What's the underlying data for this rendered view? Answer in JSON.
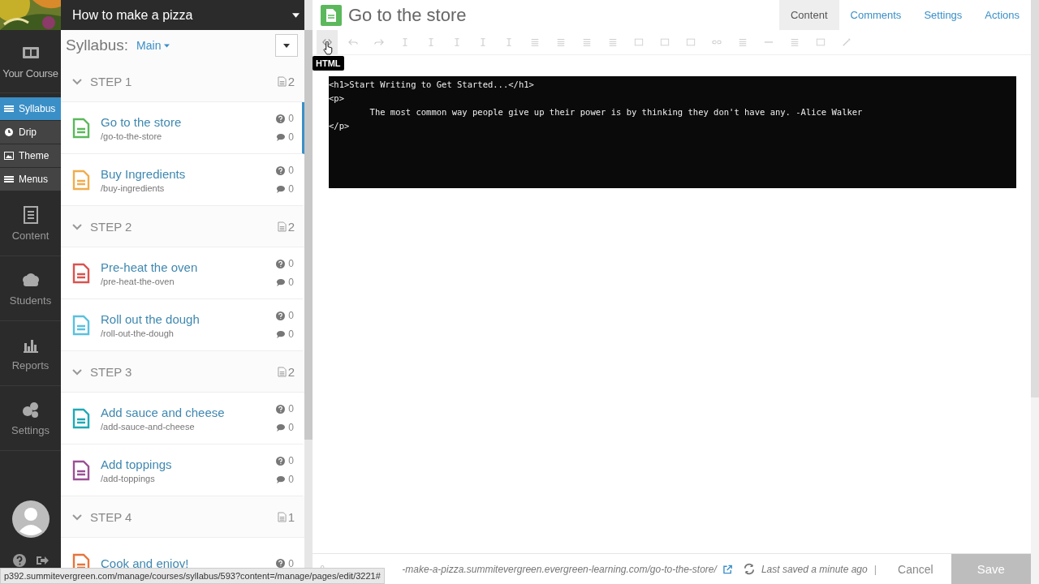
{
  "nav": {
    "items": [
      {
        "label": "Your Course",
        "kind": "large",
        "selected": false
      },
      {
        "label": "Syllabus",
        "kind": "small",
        "selected": true
      },
      {
        "label": "Drip",
        "kind": "small",
        "selected": false
      },
      {
        "label": "Theme",
        "kind": "small",
        "selected": false
      },
      {
        "label": "Menus",
        "kind": "small",
        "selected": false
      },
      {
        "label": "Content",
        "kind": "large",
        "selected": false
      },
      {
        "label": "Students",
        "kind": "large",
        "selected": false
      },
      {
        "label": "Reports",
        "kind": "large",
        "selected": false
      },
      {
        "label": "Settings",
        "kind": "large",
        "selected": false
      }
    ]
  },
  "course": {
    "title": "How to make a pizza"
  },
  "syllabus": {
    "label": "Syllabus:",
    "menu": "Main",
    "steps": [
      {
        "title": "STEP 1",
        "count": "2",
        "expanded": true,
        "items": [
          {
            "title": "Go to the store",
            "slug": "/go-to-the-store",
            "color": "#5cb85c",
            "questions": "0",
            "comments": "0",
            "selected": true
          },
          {
            "title": "Buy Ingredients",
            "slug": "/buy-ingredients",
            "color": "#f0ad4e",
            "questions": "0",
            "comments": "0",
            "selected": false
          }
        ]
      },
      {
        "title": "STEP 2",
        "count": "2",
        "expanded": true,
        "items": [
          {
            "title": "Pre-heat the oven",
            "slug": "/pre-heat-the-oven",
            "color": "#d9534f",
            "questions": "0",
            "comments": "0",
            "selected": false
          },
          {
            "title": "Roll out the dough",
            "slug": "/roll-out-the-dough",
            "color": "#5bc0de",
            "questions": "0",
            "comments": "0",
            "selected": false
          }
        ]
      },
      {
        "title": "STEP 3",
        "count": "2",
        "expanded": true,
        "items": [
          {
            "title": "Add sauce and cheese",
            "slug": "/add-sauce-and-cheese",
            "color": "#1fa9b5",
            "questions": "0",
            "comments": "0",
            "selected": false
          },
          {
            "title": "Add toppings",
            "slug": "/add-toppings",
            "color": "#9c4f96",
            "questions": "0",
            "comments": "0",
            "selected": false
          }
        ]
      },
      {
        "title": "STEP 4",
        "count": "1",
        "expanded": true,
        "items": [
          {
            "title": "Cook and enjoy!",
            "color": "#e8743b",
            "questions": "0",
            "selected": false
          }
        ]
      }
    ]
  },
  "page": {
    "title": "Go to the store",
    "tabs": [
      {
        "label": "Content",
        "selected": true
      },
      {
        "label": "Comments",
        "selected": false
      },
      {
        "label": "Settings",
        "selected": false
      },
      {
        "label": "Actions",
        "selected": false
      }
    ]
  },
  "editor": {
    "tooltip": "HTML",
    "code": [
      "<h1>Start Writing to Get Started...</h1>",
      "<p>",
      "        The most common way people give up their power is by thinking they don't have any. -Alice Walker",
      "</p>"
    ]
  },
  "footer": {
    "url": "-make-a-pizza.summitevergreen.evergreen-learning.com/go-to-the-store/",
    "saved": "Last saved a minute ago",
    "separator": "|",
    "cancel": "Cancel",
    "save": "Save"
  },
  "status_url": "p392.summitevergreen.com/manage/courses/syllabus/593?content=/manage/pages/edit/3221#"
}
